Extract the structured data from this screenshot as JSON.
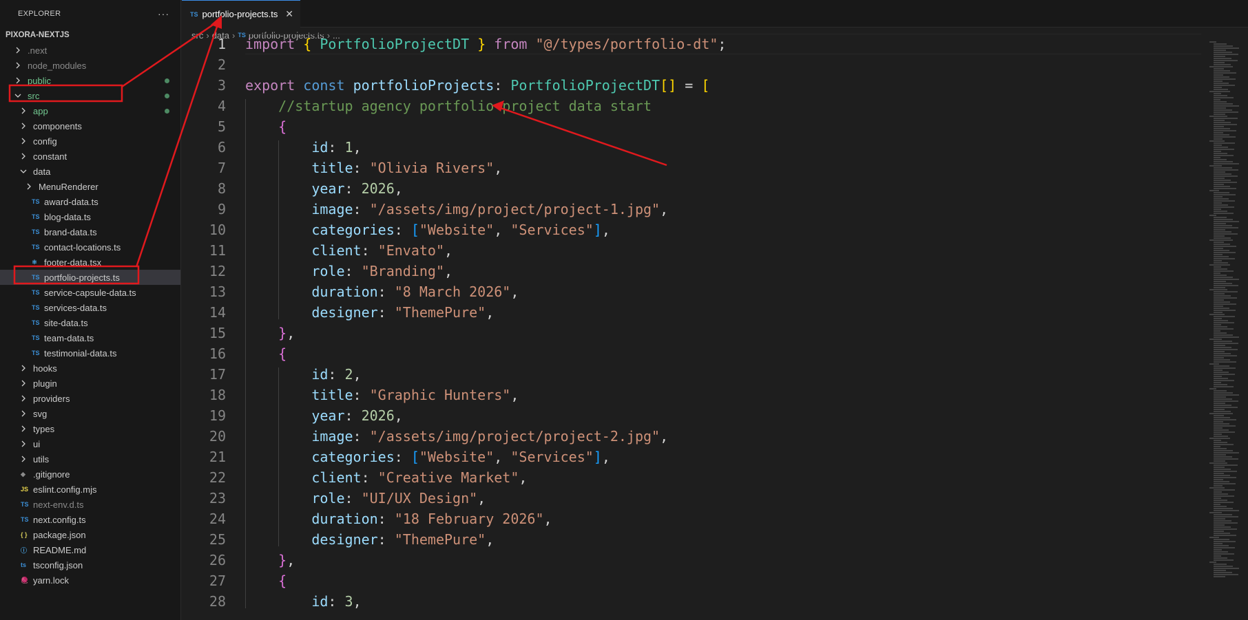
{
  "explorer": {
    "title": "EXPLORER",
    "more": "···",
    "project": "PIXORA-NEXTJS",
    "items": [
      {
        "label": ".next",
        "type": "folder",
        "depth": 0,
        "open": false,
        "tone": "dim"
      },
      {
        "label": "node_modules",
        "type": "folder",
        "depth": 0,
        "open": false,
        "tone": "dim"
      },
      {
        "label": "public",
        "type": "folder",
        "depth": 0,
        "open": false,
        "tone": "green",
        "dot": true
      },
      {
        "label": "src",
        "type": "folder",
        "depth": 0,
        "open": true,
        "tone": "green",
        "dot": true
      },
      {
        "label": "app",
        "type": "folder",
        "depth": 1,
        "open": false,
        "tone": "green",
        "dot": true
      },
      {
        "label": "components",
        "type": "folder",
        "depth": 1,
        "open": false
      },
      {
        "label": "config",
        "type": "folder",
        "depth": 1,
        "open": false
      },
      {
        "label": "constant",
        "type": "folder",
        "depth": 1,
        "open": false
      },
      {
        "label": "data",
        "type": "folder",
        "depth": 1,
        "open": true
      },
      {
        "label": "MenuRenderer",
        "type": "folder",
        "depth": 2,
        "open": false
      },
      {
        "label": "award-data.ts",
        "type": "ts",
        "depth": 2
      },
      {
        "label": "blog-data.ts",
        "type": "ts",
        "depth": 2
      },
      {
        "label": "brand-data.ts",
        "type": "ts",
        "depth": 2
      },
      {
        "label": "contact-locations.ts",
        "type": "ts",
        "depth": 2
      },
      {
        "label": "footer-data.tsx",
        "type": "tsx",
        "depth": 2
      },
      {
        "label": "portfolio-projects.ts",
        "type": "ts",
        "depth": 2,
        "selected": true
      },
      {
        "label": "service-capsule-data.ts",
        "type": "ts",
        "depth": 2
      },
      {
        "label": "services-data.ts",
        "type": "ts",
        "depth": 2
      },
      {
        "label": "site-data.ts",
        "type": "ts",
        "depth": 2
      },
      {
        "label": "team-data.ts",
        "type": "ts",
        "depth": 2
      },
      {
        "label": "testimonial-data.ts",
        "type": "ts",
        "depth": 2
      },
      {
        "label": "hooks",
        "type": "folder",
        "depth": 1,
        "open": false
      },
      {
        "label": "plugin",
        "type": "folder",
        "depth": 1,
        "open": false
      },
      {
        "label": "providers",
        "type": "folder",
        "depth": 1,
        "open": false
      },
      {
        "label": "svg",
        "type": "folder",
        "depth": 1,
        "open": false
      },
      {
        "label": "types",
        "type": "folder",
        "depth": 1,
        "open": false
      },
      {
        "label": "ui",
        "type": "folder",
        "depth": 1,
        "open": false
      },
      {
        "label": "utils",
        "type": "folder",
        "depth": 1,
        "open": false
      },
      {
        "label": ".gitignore",
        "type": "git",
        "depth": 0
      },
      {
        "label": "eslint.config.mjs",
        "type": "js",
        "depth": 0
      },
      {
        "label": "next-env.d.ts",
        "type": "ts",
        "depth": 0,
        "tone": "dim"
      },
      {
        "label": "next.config.ts",
        "type": "ts",
        "depth": 0
      },
      {
        "label": "package.json",
        "type": "json",
        "depth": 0
      },
      {
        "label": "README.md",
        "type": "info",
        "depth": 0
      },
      {
        "label": "tsconfig.json",
        "type": "tsconfig",
        "depth": 0
      },
      {
        "label": "yarn.lock",
        "type": "yarn",
        "depth": 0
      }
    ]
  },
  "icons": {
    "ts": "TS",
    "js": "JS",
    "json": "{ }",
    "tsx": "⚛",
    "git": "◆",
    "info": "ⓘ",
    "tsconfig": "ts",
    "yarn": "🧶"
  },
  "tab": {
    "badge": "TS",
    "label": "portfolio-projects.ts",
    "close": "✕"
  },
  "breadcrumb": {
    "parts": [
      "src",
      "data"
    ],
    "badge": "TS",
    "file": "portfolio-projects.ts",
    "tail": "..."
  },
  "editor": {
    "lines": [
      [
        [
          "kw",
          "import"
        ],
        [
          "p",
          " "
        ],
        [
          "b1",
          "{"
        ],
        [
          "p",
          " "
        ],
        [
          "type",
          "PortfolioProjectDT"
        ],
        [
          "p",
          " "
        ],
        [
          "b1",
          "}"
        ],
        [
          "p",
          " "
        ],
        [
          "kw",
          "from"
        ],
        [
          "p",
          " "
        ],
        [
          "str",
          "\"@/types/portfolio-dt\""
        ],
        [
          "p",
          ";"
        ]
      ],
      [],
      [
        [
          "kw",
          "export"
        ],
        [
          "p",
          " "
        ],
        [
          "kw2",
          "const"
        ],
        [
          "p",
          " "
        ],
        [
          "var",
          "portfolioProjects"
        ],
        [
          "p",
          ": "
        ],
        [
          "type",
          "PortfolioProjectDT"
        ],
        [
          "b1",
          "[]"
        ],
        [
          "p",
          " = "
        ],
        [
          "b1",
          "["
        ]
      ],
      [
        [
          "p",
          "    "
        ],
        [
          "com",
          "//startup agency portfolio project data start"
        ]
      ],
      [
        [
          "p",
          "    "
        ],
        [
          "b2",
          "{"
        ]
      ],
      [
        [
          "p",
          "        "
        ],
        [
          "var",
          "id"
        ],
        [
          "p",
          ": "
        ],
        [
          "num",
          "1"
        ],
        [
          "p",
          ","
        ]
      ],
      [
        [
          "p",
          "        "
        ],
        [
          "var",
          "title"
        ],
        [
          "p",
          ": "
        ],
        [
          "str",
          "\"Olivia Rivers\""
        ],
        [
          "p",
          ","
        ]
      ],
      [
        [
          "p",
          "        "
        ],
        [
          "var",
          "year"
        ],
        [
          "p",
          ": "
        ],
        [
          "num",
          "2026"
        ],
        [
          "p",
          ","
        ]
      ],
      [
        [
          "p",
          "        "
        ],
        [
          "var",
          "image"
        ],
        [
          "p",
          ": "
        ],
        [
          "str",
          "\"/assets/img/project/project-1.jpg\""
        ],
        [
          "p",
          ","
        ]
      ],
      [
        [
          "p",
          "        "
        ],
        [
          "var",
          "categories"
        ],
        [
          "p",
          ": "
        ],
        [
          "b3",
          "["
        ],
        [
          "str",
          "\"Website\""
        ],
        [
          "p",
          ", "
        ],
        [
          "str",
          "\"Services\""
        ],
        [
          "b3",
          "]"
        ],
        [
          "p",
          ","
        ]
      ],
      [
        [
          "p",
          "        "
        ],
        [
          "var",
          "client"
        ],
        [
          "p",
          ": "
        ],
        [
          "str",
          "\"Envato\""
        ],
        [
          "p",
          ","
        ]
      ],
      [
        [
          "p",
          "        "
        ],
        [
          "var",
          "role"
        ],
        [
          "p",
          ": "
        ],
        [
          "str",
          "\"Branding\""
        ],
        [
          "p",
          ","
        ]
      ],
      [
        [
          "p",
          "        "
        ],
        [
          "var",
          "duration"
        ],
        [
          "p",
          ": "
        ],
        [
          "str",
          "\"8 March 2026\""
        ],
        [
          "p",
          ","
        ]
      ],
      [
        [
          "p",
          "        "
        ],
        [
          "var",
          "designer"
        ],
        [
          "p",
          ": "
        ],
        [
          "str",
          "\"ThemePure\""
        ],
        [
          "p",
          ","
        ]
      ],
      [
        [
          "p",
          "    "
        ],
        [
          "b2",
          "}"
        ],
        [
          "p",
          ","
        ]
      ],
      [
        [
          "p",
          "    "
        ],
        [
          "b2",
          "{"
        ]
      ],
      [
        [
          "p",
          "        "
        ],
        [
          "var",
          "id"
        ],
        [
          "p",
          ": "
        ],
        [
          "num",
          "2"
        ],
        [
          "p",
          ","
        ]
      ],
      [
        [
          "p",
          "        "
        ],
        [
          "var",
          "title"
        ],
        [
          "p",
          ": "
        ],
        [
          "str",
          "\"Graphic Hunters\""
        ],
        [
          "p",
          ","
        ]
      ],
      [
        [
          "p",
          "        "
        ],
        [
          "var",
          "year"
        ],
        [
          "p",
          ": "
        ],
        [
          "num",
          "2026"
        ],
        [
          "p",
          ","
        ]
      ],
      [
        [
          "p",
          "        "
        ],
        [
          "var",
          "image"
        ],
        [
          "p",
          ": "
        ],
        [
          "str",
          "\"/assets/img/project/project-2.jpg\""
        ],
        [
          "p",
          ","
        ]
      ],
      [
        [
          "p",
          "        "
        ],
        [
          "var",
          "categories"
        ],
        [
          "p",
          ": "
        ],
        [
          "b3",
          "["
        ],
        [
          "str",
          "\"Website\""
        ],
        [
          "p",
          ", "
        ],
        [
          "str",
          "\"Services\""
        ],
        [
          "b3",
          "]"
        ],
        [
          "p",
          ","
        ]
      ],
      [
        [
          "p",
          "        "
        ],
        [
          "var",
          "client"
        ],
        [
          "p",
          ": "
        ],
        [
          "str",
          "\"Creative Market\""
        ],
        [
          "p",
          ","
        ]
      ],
      [
        [
          "p",
          "        "
        ],
        [
          "var",
          "role"
        ],
        [
          "p",
          ": "
        ],
        [
          "str",
          "\"UI/UX Design\""
        ],
        [
          "p",
          ","
        ]
      ],
      [
        [
          "p",
          "        "
        ],
        [
          "var",
          "duration"
        ],
        [
          "p",
          ": "
        ],
        [
          "str",
          "\"18 February 2026\""
        ],
        [
          "p",
          ","
        ]
      ],
      [
        [
          "p",
          "        "
        ],
        [
          "var",
          "designer"
        ],
        [
          "p",
          ": "
        ],
        [
          "str",
          "\"ThemePure\""
        ],
        [
          "p",
          ","
        ]
      ],
      [
        [
          "p",
          "    "
        ],
        [
          "b2",
          "}"
        ],
        [
          "p",
          ","
        ]
      ],
      [
        [
          "p",
          "    "
        ],
        [
          "b2",
          "{"
        ]
      ],
      [
        [
          "p",
          "        "
        ],
        [
          "var",
          "id"
        ],
        [
          "p",
          ": "
        ],
        [
          "num",
          "3"
        ],
        [
          "p",
          ","
        ]
      ]
    ]
  },
  "colors": {
    "annotation": "#e0191d",
    "selection": "#37373d",
    "accent": "#3b8eea"
  }
}
